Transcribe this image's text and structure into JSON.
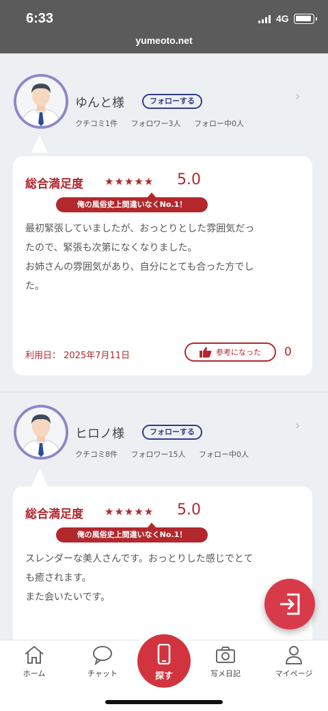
{
  "status_bar": {
    "time": "6:33",
    "network": "4G",
    "url": "yumeoto.net"
  },
  "reviews": [
    {
      "username": "ゆんと様",
      "follow_label": "フォローする",
      "stats": {
        "reviews": "クチコミ1件",
        "followers": "フォロワー3人",
        "following": "フォロー中0人"
      },
      "satisfaction_label": "総合満足度",
      "stars": "★★★★★",
      "score": "5.0",
      "ribbon": "俺の風俗史上間違いなくNo.1！",
      "lines": [
        "最初緊張していましたが、おっとりとした雰囲気だっ",
        "たので、緊張も次第になくなりました。",
        "お姉さんの雰囲気があり、自分にとても合った方でし",
        "た。"
      ],
      "use_date": "利用日： 2025年7月11日",
      "helpful_label": "参考になった",
      "helpful_count": "0"
    },
    {
      "username": "ヒロノ様",
      "follow_label": "フォローする",
      "stats": {
        "reviews": "クチコミ8件",
        "followers": "フォロワー15人",
        "following": "フォロー中0人"
      },
      "satisfaction_label": "総合満足度",
      "stars": "★★★★★",
      "score": "5.0",
      "ribbon": "俺の風俗史上間違いなくNo.1！",
      "lines": [
        "スレンダーな美人さんです。おっとりした感じでとて",
        "も癒されます。",
        "また会いたいです。"
      ]
    }
  ],
  "bottom_nav": {
    "home": "ホーム",
    "chat": "チャット",
    "search": "探す",
    "photo_diary": "写メ日記",
    "mypage": "マイページ"
  },
  "colors": {
    "accent": "#b3282d",
    "follow": "#2e3a8c",
    "avatar_ring": "#8e86c9",
    "fab": "#d83a4a"
  }
}
